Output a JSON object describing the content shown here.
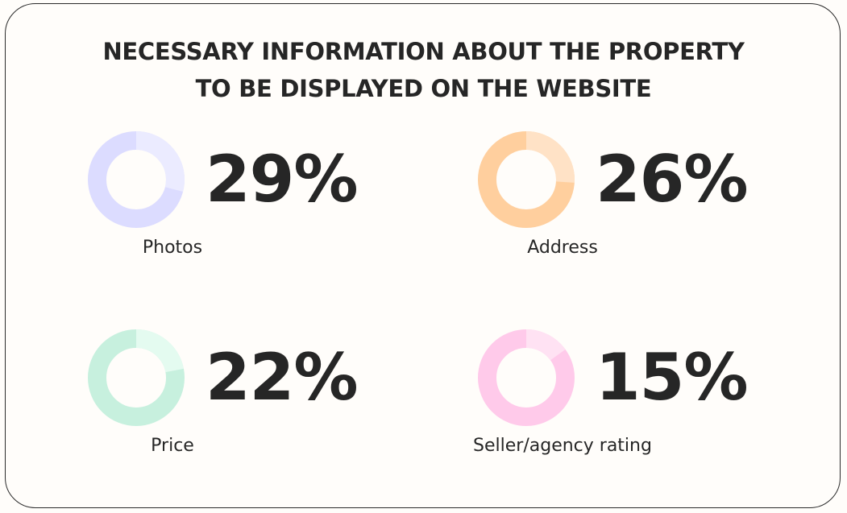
{
  "title": {
    "line1": "NECESSARY INFORMATION ABOUT THE PROPERTY",
    "line2": "TO BE DISPLAYED ON THE WEBSITE"
  },
  "chart_data": {
    "type": "pie",
    "title": "NECESSARY INFORMATION ABOUT THE PROPERTY TO BE DISPLAYED ON THE WEBSITE",
    "items": [
      {
        "label": "Photos",
        "value": 29,
        "value_text": "29%",
        "color": "#dcdcff",
        "accent": "#ebebff"
      },
      {
        "label": "Address",
        "value": 26,
        "value_text": "26%",
        "color": "#ffcf9e",
        "accent": "#ffe2c6"
      },
      {
        "label": "Price",
        "value": 22,
        "value_text": "22%",
        "color": "#c7f0de",
        "accent": "#e4fbf0"
      },
      {
        "label": "Seller/agency rating",
        "value": 15,
        "value_text": "15%",
        "color": "#ffcaea",
        "accent": "#ffe2f3"
      }
    ]
  }
}
